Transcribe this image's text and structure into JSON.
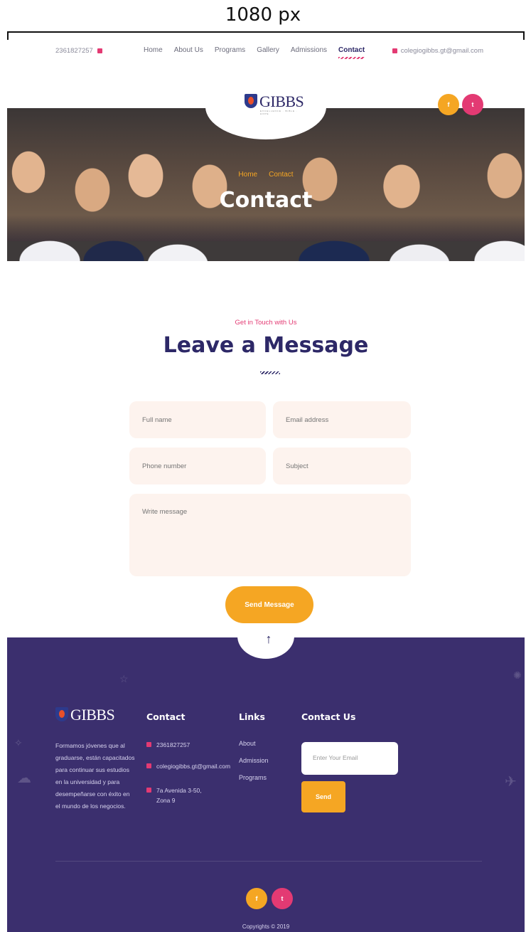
{
  "ruler": {
    "label": "1080 px"
  },
  "topbar": {
    "phone": "2361827257",
    "nav": [
      "Home",
      "About Us",
      "Programs",
      "Gallery",
      "Admissions",
      "Contact"
    ],
    "active_nav": "Contact",
    "email": "colegiogibbs.gt@gmail.com"
  },
  "brand": {
    "name": "GIBBS",
    "tagline": "EXCELLENCE · BIBLE · HOPE"
  },
  "social": {
    "facebook": "f",
    "twitter": "t"
  },
  "hero": {
    "crumbs": [
      "Home",
      "Contact"
    ],
    "title": "Contact"
  },
  "contact": {
    "kicker": "Get in Touch with Us",
    "title": "Leave a Message",
    "fields": {
      "full_name": "Full name",
      "email": "Email address",
      "phone": "Phone number",
      "subject": "Subject",
      "message": "Write message"
    },
    "button": "Send Message"
  },
  "footer": {
    "scroll_top": "↑",
    "about": "Formamos jóvenes que al graduarse, están capacitados para continuar sus estudios en la universidad y para desempeñarse con éxito en el mundo de los negocios.",
    "contact_heading": "Contact",
    "contact_items": [
      "2361827257",
      "colegiogibbs.gt@gmail.com",
      "7a Avenida 3-50, Zona 9"
    ],
    "links_heading": "Links",
    "links": [
      "About",
      "Admission",
      "Programs"
    ],
    "contact_us_heading": "Contact Us",
    "email_placeholder": "Enter Your Email",
    "send_label": "Send",
    "copyright": "Copyrights © 2019"
  },
  "colors": {
    "primary": "#2d2867",
    "accent_orange": "#f5a623",
    "accent_pink": "#e33a73",
    "footer_bg": "#3b2f6e"
  }
}
